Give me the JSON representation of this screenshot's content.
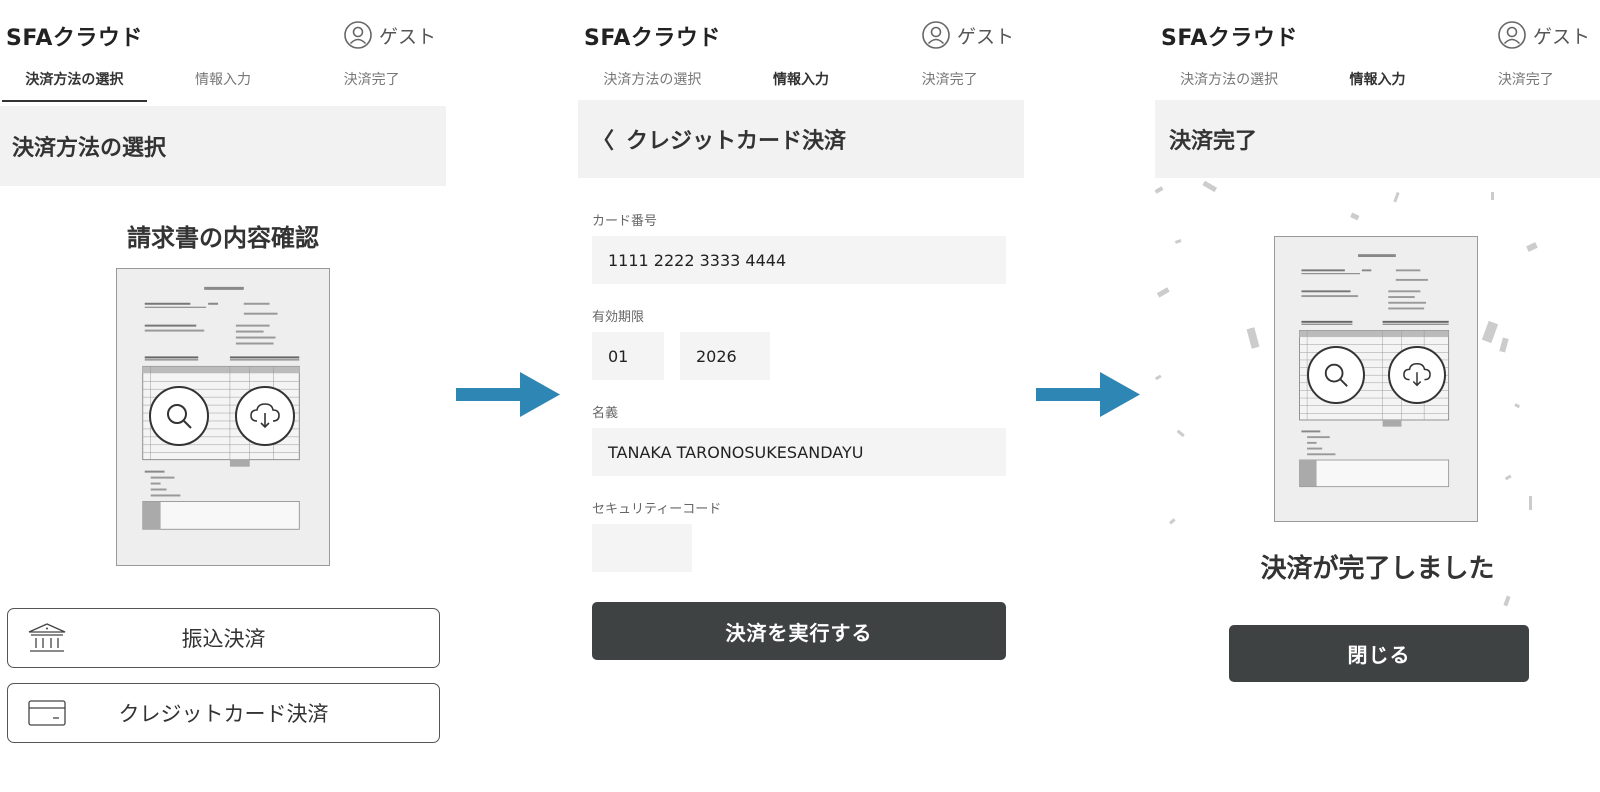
{
  "app": {
    "title": "SFAクラウド",
    "user_label": "ゲスト"
  },
  "tabs": [
    "決済方法の選択",
    "情報入力",
    "決済完了"
  ],
  "step1": {
    "heading": "決済方法の選択",
    "invoice_title": "請求書の内容確認",
    "methods": {
      "bank_transfer": "振込決済",
      "credit_card": "クレジットカード決済"
    }
  },
  "step2": {
    "heading": "クレジットカード決済",
    "card_number_label": "カード番号",
    "card_number": "1111 2222 3333 4444",
    "expiry_label": "有効期限",
    "expiry_month": "01",
    "expiry_year": "2026",
    "name_label": "名義",
    "name_value": "TANAKA TARONOSUKESANDAYU",
    "security_label": "セキュリティーコード",
    "security_value": "",
    "submit_label": "決済を実行する"
  },
  "step3": {
    "heading": "決済完了",
    "message": "決済が完了しました",
    "close_label": "閉じる"
  },
  "colors": {
    "accent_arrow": "#2e86b5",
    "primary_button": "#3e4242",
    "panel_bg": "#f2f2f2",
    "field_bg": "#f4f4f4"
  }
}
